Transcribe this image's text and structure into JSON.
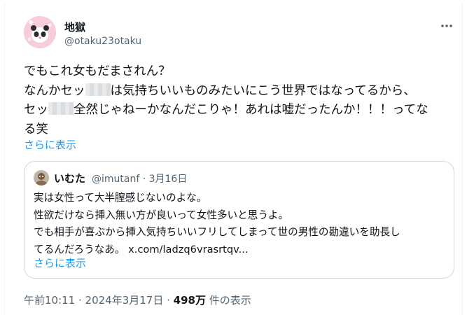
{
  "author": {
    "display_name": "地獄",
    "handle": "@otaku23otaku",
    "avatar_icon": "avatar-icon"
  },
  "tweet": {
    "line1": "でもこれ女もだまされん？",
    "line2a": "なんかセッ",
    "line2b": "は気持ちいいものみたいにこう世界ではなってるから、",
    "line3a": "セッ",
    "line3b": "全然じゃねーかなんだこりゃ！あれは嘘だったんか！！！ってな",
    "line4": "る笑",
    "show_more": "さらに表示"
  },
  "quote": {
    "display_name": "いむた",
    "meta": "@imutanf · 3月16日",
    "line1": "実は女性って大半膣感じないのよな。",
    "line2": "性欲だけなら挿入無い方が良いって女性多いと思うよ。",
    "line3": "でも相手が喜ぶから挿入気持ちいいフリしてしまって世の男性の勘違いを助長し",
    "line4a": "てるんだろうなあ。 ",
    "link": "x.com/ladzq6vrasrtqv...",
    "show_more": "さらに表示"
  },
  "footer": {
    "time": "午前10:11 · 2024年3月17日 · ",
    "views": "498万",
    "views_label": " 件の表示"
  },
  "colors": {
    "link": "#1d9bf0",
    "secondary": "#536471",
    "border": "#cfd9de"
  }
}
